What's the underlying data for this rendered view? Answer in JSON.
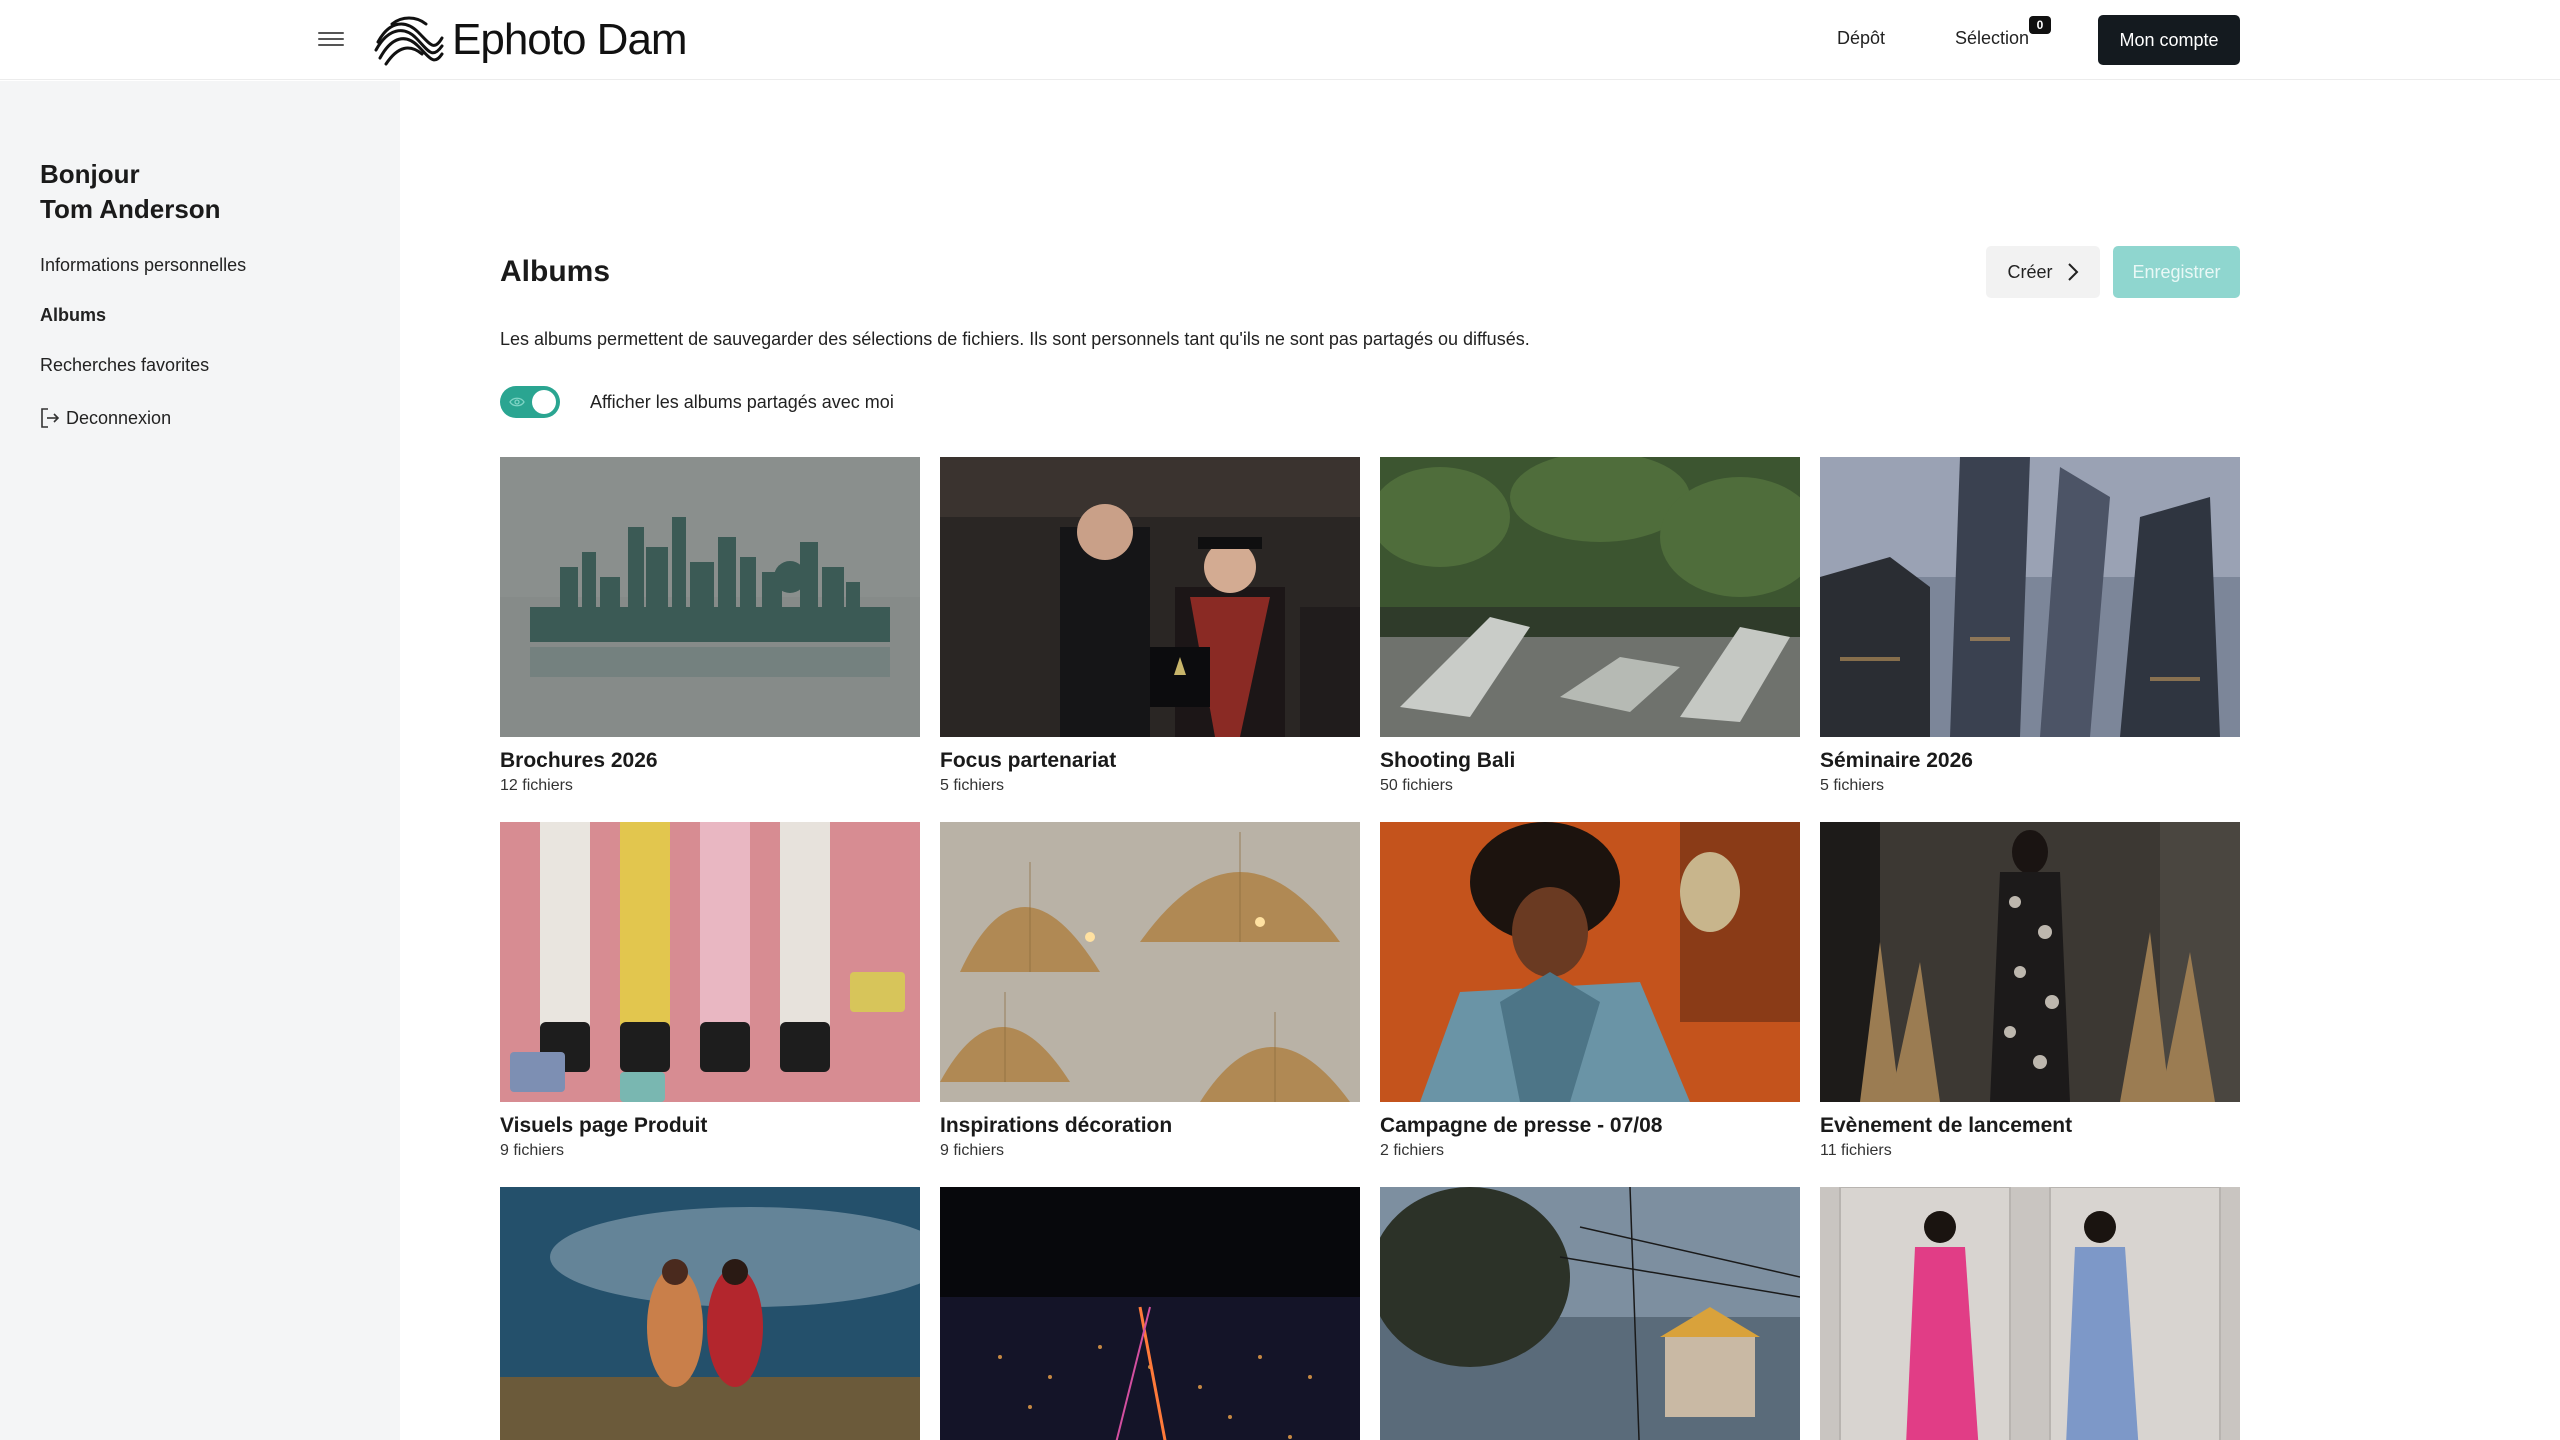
{
  "header": {
    "brand": "Ephoto Dam",
    "nav_depot": "Dépôt",
    "nav_selection": "Sélection",
    "selection_count": "0",
    "account_button": "Mon compte"
  },
  "sidebar": {
    "greeting_line1": "Bonjour",
    "greeting_line2": "Tom Anderson",
    "items": [
      {
        "label": "Informations personnelles"
      },
      {
        "label": "Albums"
      },
      {
        "label": "Recherches favorites"
      },
      {
        "label": "Deconnexion"
      }
    ]
  },
  "main": {
    "title": "Albums",
    "create_button": "Créer",
    "save_button": "Enregistrer",
    "description": "Les albums permettent de sauvegarder des sélections de fichiers. Ils sont personnels tant qu'ils ne sont pas partagés ou diffusés.",
    "toggle_label": "Afficher les albums partagés avec moi",
    "toggle_on": true
  },
  "albums": [
    {
      "name": "Brochures 2026",
      "count": "12 fichiers"
    },
    {
      "name": "Focus partenariat",
      "count": "5 fichiers"
    },
    {
      "name": "Shooting Bali",
      "count": "50 fichiers"
    },
    {
      "name": "Séminaire 2026",
      "count": "5 fichiers"
    },
    {
      "name": "Visuels page Produit",
      "count": "9 fichiers"
    },
    {
      "name": "Inspirations décoration",
      "count": "9 fichiers"
    },
    {
      "name": "Campagne de presse - 07/08",
      "count": "2 fichiers"
    },
    {
      "name": "Evènement de lancement",
      "count": "11 fichiers"
    },
    {
      "name": "",
      "count": ""
    },
    {
      "name": "",
      "count": ""
    },
    {
      "name": "",
      "count": ""
    },
    {
      "name": "",
      "count": ""
    }
  ],
  "colors": {
    "accent": "#2aa591",
    "save_button": "#8fd6cf",
    "account_button": "#141a1f",
    "sidebar_bg": "#f4f5f6"
  }
}
